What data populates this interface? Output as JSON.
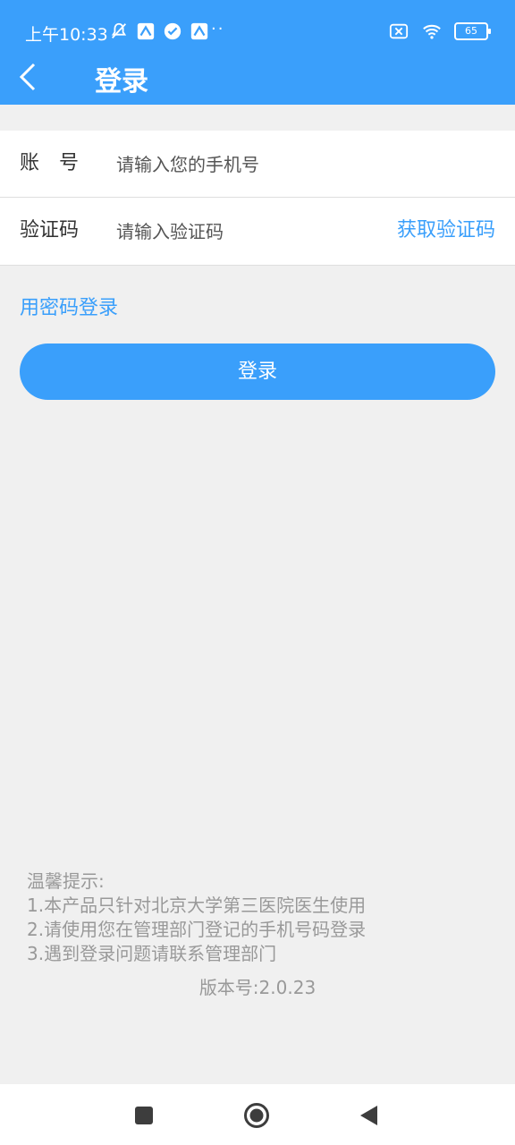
{
  "status_bar": {
    "time": "上午10:33",
    "battery": "65",
    "icons": [
      "mute-bell-icon",
      "app-icon",
      "check-icon",
      "app-icon",
      "sim-icon",
      "wifi-icon",
      "battery-icon"
    ]
  },
  "header": {
    "title": "登录",
    "back_icon": "chevron-left-icon"
  },
  "form": {
    "account_label": "账　号",
    "account_placeholder": "请输入您的手机号",
    "account_value": "",
    "code_label": "验证码",
    "code_placeholder": "请输入验证码",
    "code_value": "",
    "get_code_label": "获取验证码"
  },
  "password_login_link": "用密码登录",
  "login_button": "登录",
  "tips": {
    "heading": "温馨提示:",
    "lines": [
      "1.本产品只针对北京大学第三医院医生使用",
      "2.请使用您在管理部门登记的手机号码登录",
      "3.遇到登录问题请联系管理部门"
    ]
  },
  "version": "版本号:2.0.23",
  "colors": {
    "primary": "#3a9ffb",
    "background": "#f0f0f0"
  }
}
